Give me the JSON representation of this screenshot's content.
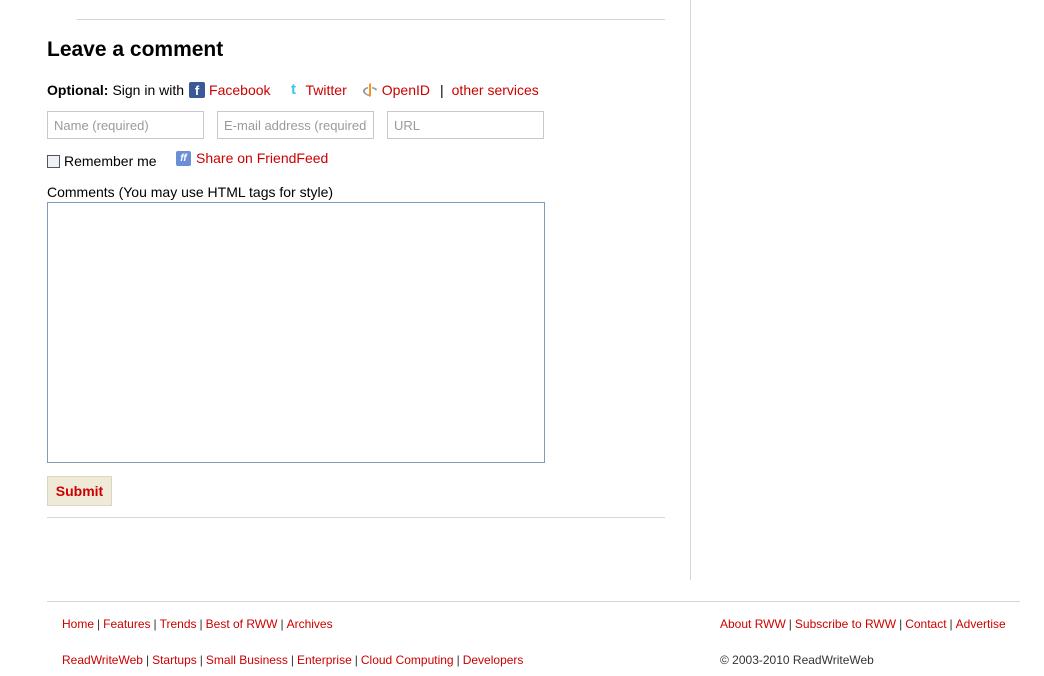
{
  "comment_form": {
    "heading": "Leave a comment",
    "optional_label": "Optional:",
    "sign_in_text": "Sign in with",
    "services": [
      {
        "label": "Facebook",
        "icon": "facebook-icon"
      },
      {
        "label": "Twitter",
        "icon": "twitter-icon"
      },
      {
        "label": "OpenID",
        "icon": "openid-icon"
      }
    ],
    "separator": "|",
    "other_services": "other services",
    "name_placeholder": "Name (required)",
    "email_placeholder": "E-mail address (required)",
    "url_placeholder": "URL",
    "remember_me": "Remember me",
    "share_friendfeed": "Share on FriendFeed",
    "comments_label": "Comments (You may use HTML tags for style)",
    "submit_label": "Submit"
  },
  "footer": {
    "links_row1": [
      "Home",
      "Features",
      "Trends",
      "Best of RWW",
      "Archives"
    ],
    "links_row2": [
      "ReadWriteWeb",
      "Startups",
      "Small Business",
      "Enterprise",
      "Cloud Computing",
      "Developers"
    ],
    "links_right": [
      "About RWW",
      "Subscribe to RWW",
      "Contact",
      "Advertise"
    ],
    "separator": "|",
    "copyright": "© 2003-2010 ReadWriteWeb"
  },
  "colors": {
    "link": "#cc0000",
    "submit_bg": "#efe9d8",
    "rule": "#d6d6d6"
  }
}
